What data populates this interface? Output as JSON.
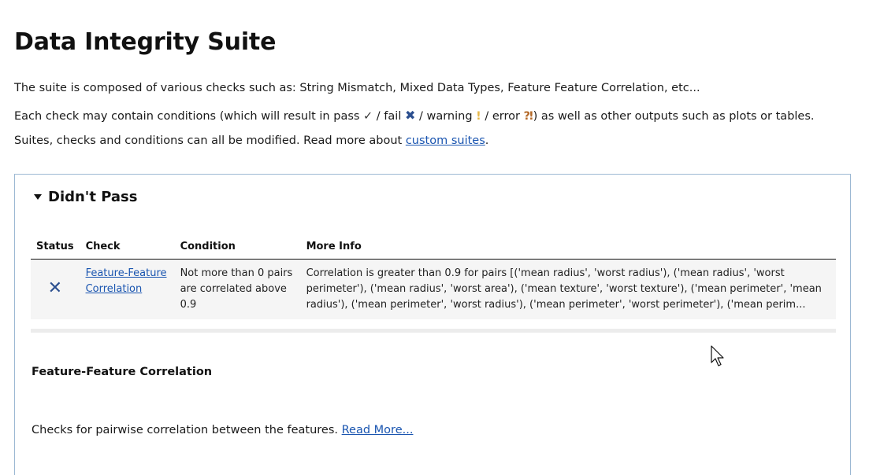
{
  "page": {
    "title": "Data Integrity Suite"
  },
  "intro": {
    "line1": "The suite is composed of various checks such as: String Mismatch, Mixed Data Types, Feature Feature Correlation, etc...",
    "line2_pre": "Each check may contain conditions (which will result in pass ",
    "pass_glyph": "✓",
    "line2_fail": " / fail ",
    "fail_glyph": "✖",
    "line2_warning": " / warning ",
    "warning_glyph": "!",
    "line2_error": " / error ",
    "error_glyph": "⁈",
    "line2_post": ") as well as other outputs such as plots or tables.",
    "line3_pre": "Suites, checks and conditions can all be modified. Read more about ",
    "line3_link": "custom suites",
    "line3_post": "."
  },
  "section": {
    "summary_title": "Didn't Pass",
    "table": {
      "headers": [
        "Status",
        "Check",
        "Condition",
        "More Info"
      ],
      "rows": [
        {
          "status_icon": "✕",
          "check": "Feature-Feature Correlation",
          "condition": "Not more than 0 pairs are correlated above 0.9",
          "more_info": "Correlation is greater than 0.9 for pairs [('mean radius', 'worst radius'), ('mean radius', 'worst perimeter'), ('mean radius', 'worst area'), ('mean texture', 'worst texture'), ('mean perimeter', 'mean radius'), ('mean perimeter', 'worst radius'), ('mean perimeter', 'worst perimeter'), ('mean perim..."
        }
      ]
    },
    "check_detail": {
      "title": "Feature-Feature Correlation",
      "description": "Checks for pairwise correlation between the features. ",
      "read_more": "Read More..."
    }
  },
  "colors": {
    "link": "#1a55b0",
    "fail_icon": "#2b4f8f",
    "panel_border": "#9cb8d3",
    "row_background": "#f5f5f5"
  }
}
